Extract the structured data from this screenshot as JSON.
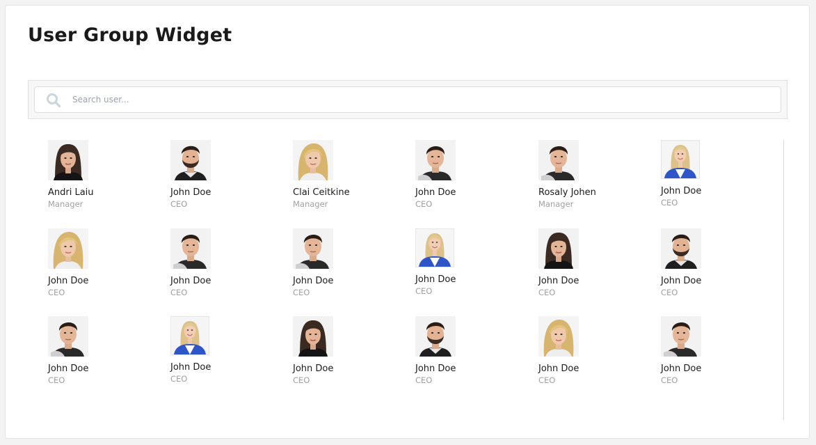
{
  "widget": {
    "title": "User Group Widget"
  },
  "search": {
    "placeholder": "Search user...",
    "value": ""
  },
  "colors": {
    "accent_blue": "#2f56c9",
    "muted_text": "#a0a0a0",
    "search_icon": "#c9d6dc"
  },
  "users": [
    {
      "name": "Andri Laiu",
      "role": "Manager",
      "avatar": "woman-dark"
    },
    {
      "name": "John Doe",
      "role": "CEO",
      "avatar": "man-beard"
    },
    {
      "name": "Clai Ceitkine",
      "role": "Manager",
      "avatar": "woman-blonde"
    },
    {
      "name": "John Doe",
      "role": "CEO",
      "avatar": "man-shaven"
    },
    {
      "name": "Rosaly Johen",
      "role": "Manager",
      "avatar": "man-shaven"
    },
    {
      "name": "John Doe",
      "role": "CEO",
      "avatar": "woman-blue"
    },
    {
      "name": "John Doe",
      "role": "CEO",
      "avatar": "woman-blonde"
    },
    {
      "name": "John Doe",
      "role": "CEO",
      "avatar": "man-shaven"
    },
    {
      "name": "John Doe",
      "role": "CEO",
      "avatar": "man-shaven"
    },
    {
      "name": "John Doe",
      "role": "CEO",
      "avatar": "woman-blue"
    },
    {
      "name": "John Doe",
      "role": "CEO",
      "avatar": "woman-dark"
    },
    {
      "name": "John Doe",
      "role": "CEO",
      "avatar": "man-beard"
    },
    {
      "name": "John Doe",
      "role": "CEO",
      "avatar": "man-shaven"
    },
    {
      "name": "John Doe",
      "role": "CEO",
      "avatar": "woman-blue"
    },
    {
      "name": "John Doe",
      "role": "CEO",
      "avatar": "woman-dark"
    },
    {
      "name": "John Doe",
      "role": "CEO",
      "avatar": "man-beard"
    },
    {
      "name": "John Doe",
      "role": "CEO",
      "avatar": "woman-blonde"
    },
    {
      "name": "John Doe",
      "role": "CEO",
      "avatar": "man-shaven"
    }
  ]
}
